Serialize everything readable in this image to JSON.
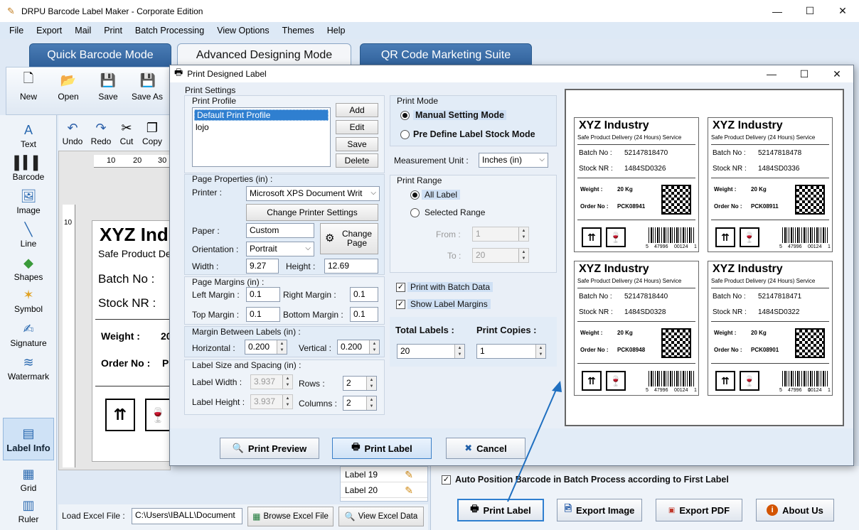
{
  "app": {
    "title": "DRPU Barcode Label Maker - Corporate Edition",
    "menu": [
      "File",
      "Export",
      "Mail",
      "Print",
      "Batch Processing",
      "View Options",
      "Themes",
      "Help"
    ],
    "mode_tabs": [
      "Quick Barcode Mode",
      "Advanced Designing Mode",
      "QR Code Marketing Suite"
    ],
    "toolbar": [
      "New",
      "Open",
      "Save",
      "Save As"
    ],
    "edit_tools": [
      "Undo",
      "Redo",
      "Cut",
      "Copy"
    ],
    "left_tools": [
      "Text",
      "Barcode",
      "Image",
      "Line",
      "Shapes",
      "Symbol",
      "Signature",
      "Watermark",
      "Label Info",
      "Grid",
      "Ruler"
    ],
    "ruler_marks": [
      "10",
      "20",
      "30"
    ],
    "ruler_v_marks": [
      "10"
    ]
  },
  "canvas_label": {
    "title": "XYZ Ind",
    "subtitle": "Safe Product De",
    "batch": "Batch No :",
    "stock": "Stock NR :",
    "weight": "Weight :",
    "weight_val": "20",
    "order": "Order No :",
    "order_val": "P"
  },
  "dialog": {
    "title": "Print Designed Label",
    "print_settings": "Print Settings",
    "print_profile": "Print Profile",
    "profiles": [
      "Default Print Profile",
      "lojo"
    ],
    "profile_buttons": [
      "Add",
      "Edit",
      "Save",
      "Delete"
    ],
    "page_properties": "Page Properties (in) :",
    "printer_label": "Printer :",
    "printer_value": "Microsoft XPS Document Writ",
    "change_printer": "Change Printer Settings",
    "paper_label": "Paper :",
    "paper_value": "Custom",
    "change_page": "Change Page",
    "orientation_label": "Orientation :",
    "orientation_value": "Portrait",
    "width_label": "Width :",
    "width_value": "9.27",
    "height_label": "Height :",
    "height_value": "12.69",
    "page_margins": "Page Margins (in) :",
    "left_margin_label": "Left Margin :",
    "left_margin": "0.1",
    "right_margin_label": "Right Margin :",
    "right_margin": "0.1",
    "top_margin_label": "Top Margin :",
    "top_margin": "0.1",
    "bottom_margin_label": "Bottom Margin :",
    "bottom_margin": "0.1",
    "margin_between": "Margin Between Labels (in) :",
    "horizontal_label": "Horizontal :",
    "horizontal": "0.200",
    "vertical_label": "Vertical :",
    "vertical": "0.200",
    "label_size": "Label Size and Spacing (in) :",
    "label_width_label": "Label Width :",
    "label_width": "3.937",
    "rows_label": "Rows :",
    "rows": "2",
    "label_height_label": "Label Height :",
    "label_height": "3.937",
    "columns_label": "Columns :",
    "columns": "2",
    "print_mode": "Print Mode",
    "manual_mode": "Manual Setting Mode",
    "predefine_mode": "Pre Define Label Stock Mode",
    "measurement_label": "Measurement Unit :",
    "measurement_value": "Inches (in)",
    "print_range": "Print Range",
    "all_label": "All Label",
    "selected_range": "Selected Range",
    "from_label": "From :",
    "from_value": "1",
    "to_label": "To :",
    "to_value": "20",
    "print_batch": "Print with Batch Data",
    "show_margins": "Show Label Margins",
    "total_labels_label": "Total Labels :",
    "total_labels": "20",
    "print_copies_label": "Print Copies :",
    "print_copies": "1",
    "print_preview": "Print Preview",
    "print_label": "Print Label",
    "cancel": "Cancel"
  },
  "preview_labels": [
    {
      "title": "XYZ Industry",
      "subtitle": "Safe Product Delivery (24 Hours) Service",
      "batch_label": "Batch No :",
      "batch": "52147818470",
      "stock_label": "Stock NR :",
      "stock": "1484SD0326",
      "weight_label": "Weight :",
      "weight": "20 Kg",
      "order_label": "Order No :",
      "order": "PCK08941",
      "bc_left": "5",
      "bc_mid": "47996",
      "bc_right": "00124",
      "bc_end": "1"
    },
    {
      "title": "XYZ Industry",
      "subtitle": "Safe Product Delivery (24 Hours) Service",
      "batch_label": "Batch No :",
      "batch": "52147818478",
      "stock_label": "Stock NR :",
      "stock": "1484SD0336",
      "weight_label": "Weight :",
      "weight": "20 Kg",
      "order_label": "Order No :",
      "order": "PCK08911",
      "bc_left": "5",
      "bc_mid": "47996",
      "bc_right": "00124",
      "bc_end": "1"
    },
    {
      "title": "XYZ Industry",
      "subtitle": "Safe Product Delivery (24 Hours) Service",
      "batch_label": "Batch No :",
      "batch": "52147818440",
      "stock_label": "Stock NR :",
      "stock": "1484SD0328",
      "weight_label": "Weight :",
      "weight": "20 Kg",
      "order_label": "Order No :",
      "order": "PCK08948",
      "bc_left": "5",
      "bc_mid": "47996",
      "bc_right": "00124",
      "bc_end": "1"
    },
    {
      "title": "XYZ Industry",
      "subtitle": "Safe Product Delivery (24 Hours) Service",
      "batch_label": "Batch No :",
      "batch": "52147818471",
      "stock_label": "Stock NR :",
      "stock": "1484SD0322",
      "weight_label": "Weight :",
      "weight": "20 Kg",
      "order_label": "Order No :",
      "order": "PCK08901",
      "bc_left": "5",
      "bc_mid": "47996",
      "bc_right": "00124",
      "bc_end": "1"
    }
  ],
  "label_list": [
    "Label 19",
    "Label 20"
  ],
  "auto_position": "Auto Position Barcode in Batch Process according to First Label",
  "bottom": {
    "load_excel_label": "Load Excel File :",
    "excel_path": "C:\\Users\\IBALL\\Document",
    "browse_excel": "Browse Excel File",
    "view_excel": "View Excel Data"
  },
  "actions": [
    "Print Label",
    "Export Image",
    "Export PDF",
    "About Us"
  ],
  "colors": {
    "accent": "#2a69b0",
    "tab_blue": "#3a6ea8",
    "arrow": "#1f6fc0"
  }
}
